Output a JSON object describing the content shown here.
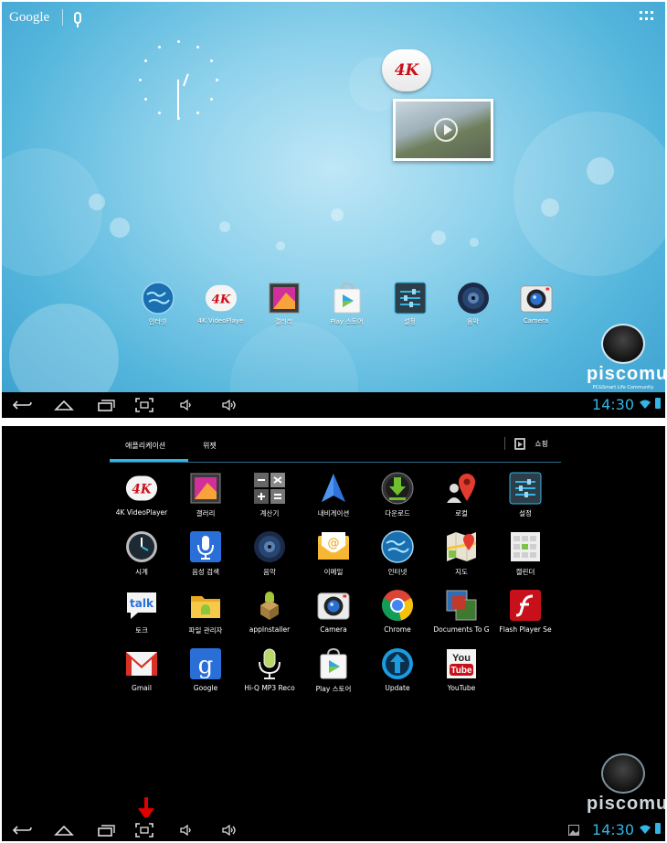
{
  "home": {
    "search_label": "Google",
    "widget_badge": "4K",
    "dock": [
      {
        "label": "인터넷",
        "icon": "globe-icon"
      },
      {
        "label": "4K VideoPlaye",
        "icon": "4k-videoplayer-icon"
      },
      {
        "label": "갤러리",
        "icon": "gallery-icon"
      },
      {
        "label": "Play 스토어",
        "icon": "play-store-icon"
      },
      {
        "label": "설정",
        "icon": "settings-icon"
      },
      {
        "label": "음악",
        "icon": "music-icon"
      },
      {
        "label": "Camera",
        "icon": "camera-icon"
      }
    ]
  },
  "status": {
    "time": "14:30"
  },
  "watermark": {
    "name": "piscomu",
    "tagline": "PC&Smart Life Community"
  },
  "drawer": {
    "tabs": [
      {
        "label": "애플리케이션"
      },
      {
        "label": "위젯"
      }
    ],
    "shop_label": "쇼핑",
    "apps": [
      {
        "label": "4K VideoPlayer",
        "icon": "4k-videoplayer-icon"
      },
      {
        "label": "갤러리",
        "icon": "gallery-icon"
      },
      {
        "label": "계산기",
        "icon": "calculator-icon"
      },
      {
        "label": "내비게이션",
        "icon": "navigation-icon"
      },
      {
        "label": "다운로드",
        "icon": "download-icon"
      },
      {
        "label": "로컬",
        "icon": "local-icon"
      },
      {
        "label": "설정",
        "icon": "settings-icon"
      },
      {
        "label": "시계",
        "icon": "clock-icon"
      },
      {
        "label": "음성 검색",
        "icon": "voice-search-icon"
      },
      {
        "label": "음악",
        "icon": "music-icon"
      },
      {
        "label": "이메일",
        "icon": "email-icon"
      },
      {
        "label": "인터넷",
        "icon": "globe-icon"
      },
      {
        "label": "지도",
        "icon": "maps-icon"
      },
      {
        "label": "캘린더",
        "icon": "calendar-icon"
      },
      {
        "label": "토크",
        "icon": "talk-icon"
      },
      {
        "label": "파일 관리자",
        "icon": "file-manager-icon"
      },
      {
        "label": "appInstaller",
        "icon": "app-installer-icon"
      },
      {
        "label": "Camera",
        "icon": "camera-icon"
      },
      {
        "label": "Chrome",
        "icon": "chrome-icon"
      },
      {
        "label": "Documents To G",
        "icon": "documents-to-go-icon"
      },
      {
        "label": "Flash Player Se",
        "icon": "flash-player-icon"
      },
      {
        "label": "Gmail",
        "icon": "gmail-icon"
      },
      {
        "label": "Google",
        "icon": "google-search-icon"
      },
      {
        "label": "Hi-Q MP3 Reco",
        "icon": "mp3-recorder-icon"
      },
      {
        "label": "Play 스토어",
        "icon": "play-store-icon"
      },
      {
        "label": "Update",
        "icon": "update-icon"
      },
      {
        "label": "YouTube",
        "icon": "youtube-icon"
      }
    ],
    "icon_text": {
      "talk": "talk",
      "google": "g",
      "you": "You",
      "tube": "Tube",
      "email_at": "@",
      "calc_ops": "− × + ="
    }
  },
  "colors": {
    "accent": "#33b5e5",
    "arrow": "#e00000"
  }
}
